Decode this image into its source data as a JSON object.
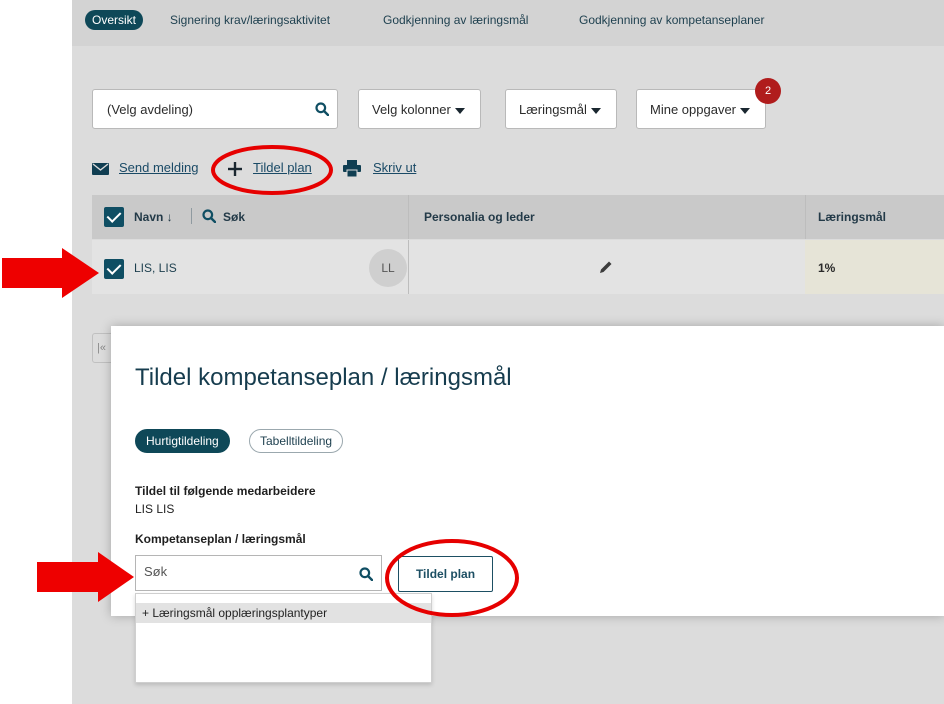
{
  "tabs": [
    "Oversikt",
    "Signering krav/læringsaktivitet",
    "Godkjenning av læringsmål",
    "Godkjenning av kompetanseplaner"
  ],
  "filters": {
    "department_placeholder": "(Velg avdeling)",
    "columns_label": "Velg kolonner",
    "goals_label": "Læringsmål",
    "tasks_label": "Mine oppgaver",
    "tasks_badge": "2"
  },
  "actions": {
    "send_message": "Send melding",
    "assign_plan": "Tildel plan",
    "print": "Skriv ut"
  },
  "table": {
    "headers": {
      "name": "Navn ↓",
      "search": "Søk",
      "personalia": "Personalia og leder",
      "goals": "Læringsmål"
    },
    "row": {
      "name": "LIS, LIS",
      "initials": "LL",
      "goals_pct": "1%"
    }
  },
  "pager": {
    "first": "|«"
  },
  "modal": {
    "title": "Tildel kompetanseplan / læringsmål",
    "pill_quick": "Hurtigtildeling",
    "pill_table": "Tabelltildeling",
    "assign_to_label": "Tildel til følgende medarbeidere",
    "assign_to_value": "LIS LIS",
    "plan_label": "Kompetanseplan / læringsmål",
    "search_placeholder": "Søk",
    "assign_button": "Tildel plan",
    "dropdown_item": "+ Læringsmål opplæringsplantyper"
  },
  "colors": {
    "accent": "#0e4858",
    "annotation": "#e60000",
    "badge": "#b01c1c"
  }
}
